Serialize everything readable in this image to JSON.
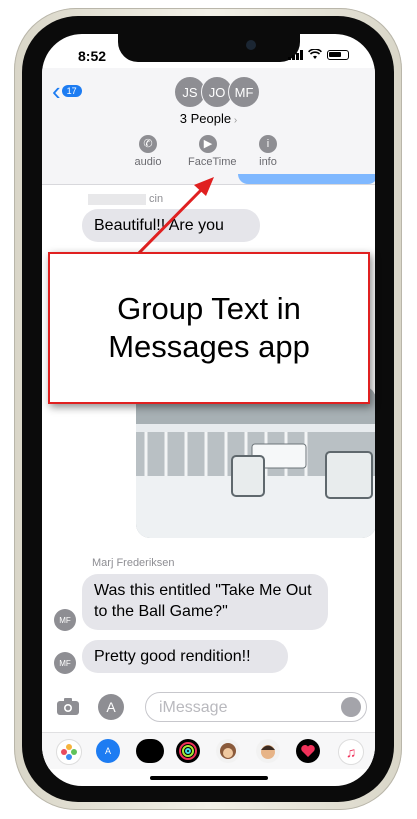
{
  "status": {
    "time": "8:52"
  },
  "header": {
    "back_count": "17",
    "avatars": [
      "JS",
      "JO",
      "MF"
    ],
    "group_title": "3 People",
    "actions": [
      {
        "icon": "phone-icon",
        "label": "audio"
      },
      {
        "icon": "video-icon",
        "label": "FaceTime"
      },
      {
        "icon": "info-icon",
        "label": "info"
      }
    ]
  },
  "thread": {
    "sender_1_suffix": "cin",
    "message_1": "Beautiful!! Are you",
    "sender_2": "Marj Frederiksen",
    "message_2": "Was this entitled \"Take Me Out to the Ball Game?\"",
    "message_3": "Pretty good rendition!!",
    "avatar_initials": "MF"
  },
  "callout": {
    "text": "Group Text in Messages app",
    "border_color": "#e02020"
  },
  "input": {
    "placeholder": "iMessage"
  },
  "app_strip": [
    "photos-icon",
    "app-store-icon",
    "apple-pay-icon",
    "activity-icon",
    "monkey-memoji-icon",
    "memoji-icon",
    "heart-icon",
    "music-icon"
  ],
  "colors": {
    "accent": "#1d7cf2",
    "bubble_gray": "#e5e5ea"
  }
}
